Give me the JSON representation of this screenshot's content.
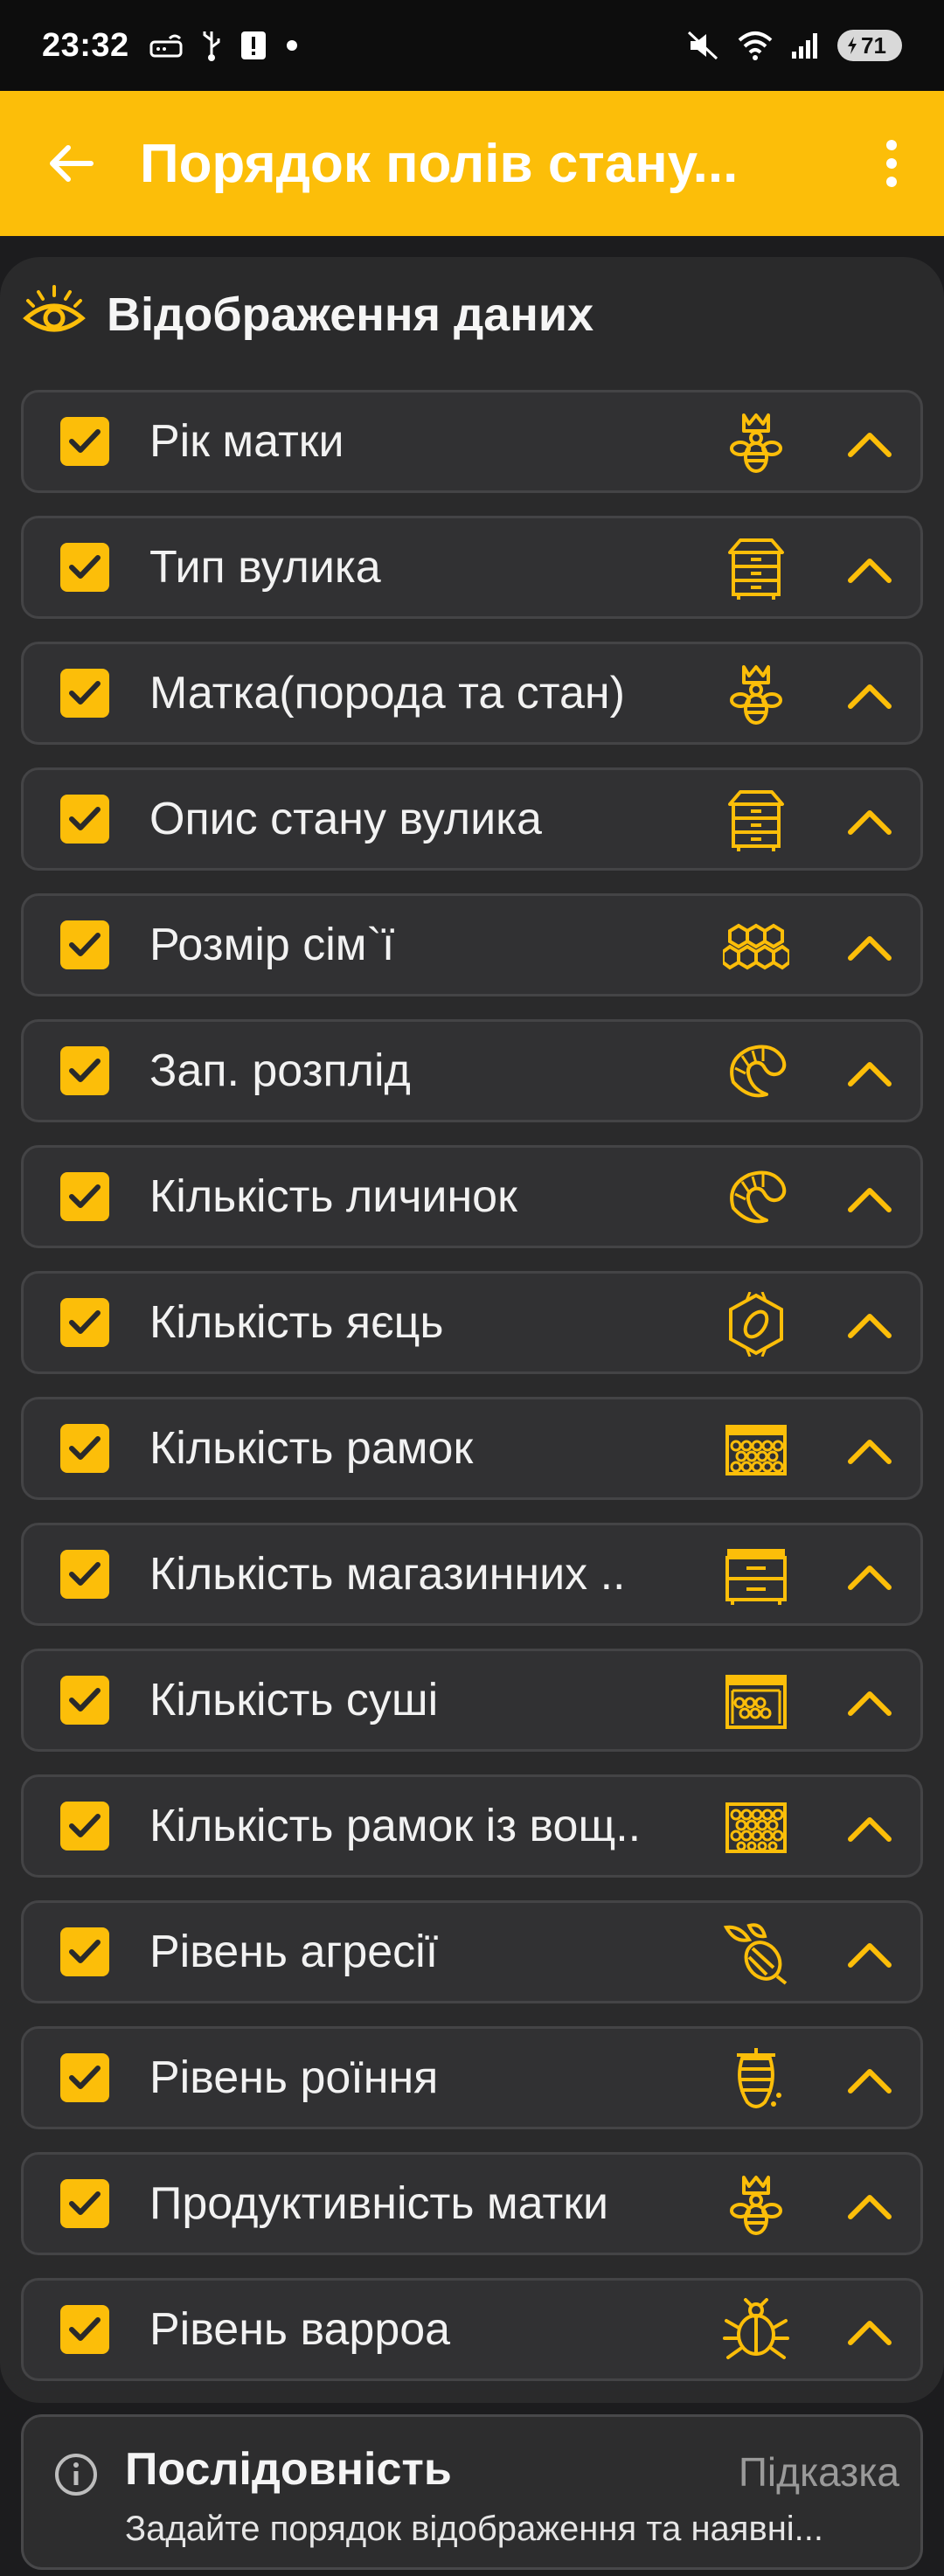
{
  "status_bar": {
    "time": "23:32",
    "battery": "71",
    "left_icons": [
      "router-icon",
      "usb-icon",
      "alert-icon",
      "dot-icon"
    ],
    "right_icons": [
      "mute-icon",
      "wifi-icon",
      "signal-icon",
      "battery-icon"
    ]
  },
  "app_bar": {
    "title": "Порядок полів стану...",
    "back_icon": "arrow-left-icon",
    "menu_icon": "more-vert-icon"
  },
  "section": {
    "title": "Відображення даних",
    "icon": "eye-icon"
  },
  "fields": [
    {
      "label": "Рік матки",
      "icon": "queen-bee-icon",
      "checked": true
    },
    {
      "label": "Тип вулика",
      "icon": "hive-icon",
      "checked": true
    },
    {
      "label": "Матка(порода та стан)",
      "icon": "queen-bee-icon",
      "checked": true
    },
    {
      "label": "Опис стану вулика",
      "icon": "hive-icon",
      "checked": true
    },
    {
      "label": "Розмір сім`ї",
      "icon": "honeycomb-icon",
      "checked": true
    },
    {
      "label": "Зап. розплід",
      "icon": "larva-icon",
      "checked": true
    },
    {
      "label": "Кількість личинок",
      "icon": "larva-icon",
      "checked": true
    },
    {
      "label": "Кількість яєць",
      "icon": "egg-cell-icon",
      "checked": true
    },
    {
      "label": "Кількість рамок",
      "icon": "frame-icon",
      "checked": true
    },
    {
      "label": "Кількість магазинних ..",
      "icon": "super-box-icon",
      "checked": true
    },
    {
      "label": "Кількість суші",
      "icon": "dry-comb-icon",
      "checked": true
    },
    {
      "label": "Кількість рамок із вощ..",
      "icon": "wax-frame-icon",
      "checked": true
    },
    {
      "label": "Рівень агресії",
      "icon": "bee-sting-icon",
      "checked": true
    },
    {
      "label": "Рівень роїння",
      "icon": "swarm-icon",
      "checked": true
    },
    {
      "label": "Продуктивність матки",
      "icon": "queen-bee-icon",
      "checked": true
    },
    {
      "label": "Рівень варроа",
      "icon": "mite-icon",
      "checked": true
    }
  ],
  "hint": {
    "title": "Послідовність",
    "link": "Підказка",
    "text": "Задайте порядок відображення та наявні...",
    "icon": "info-icon"
  },
  "colors": {
    "accent": "#fcbe09",
    "background": "#1c1c1e",
    "panel": "#2a2a2b",
    "row": "#313133"
  }
}
